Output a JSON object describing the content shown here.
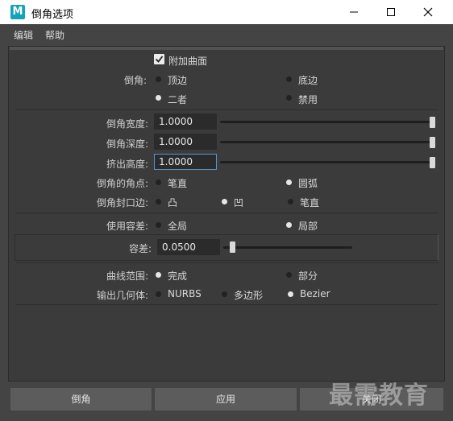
{
  "window": {
    "title": "倒角选项",
    "icon_letter": "M"
  },
  "menu": [
    "编辑",
    "帮助"
  ],
  "attach_surface": {
    "label": "附加曲面",
    "checked": true
  },
  "bevel": {
    "label": "倒角:",
    "options": [
      "顶边",
      "底边",
      "二者",
      "禁用"
    ],
    "selected": "二者"
  },
  "bevel_width": {
    "label": "倒角宽度:",
    "value": "1.0000"
  },
  "bevel_depth": {
    "label": "倒角深度:",
    "value": "1.0000"
  },
  "extrude_height": {
    "label": "挤出高度:",
    "value": "1.0000"
  },
  "bevel_corners": {
    "label": "倒角的角点:",
    "options": [
      "笔直",
      "圆弧"
    ],
    "selected": "圆弧"
  },
  "bevel_cap_edge": {
    "label": "倒角封口边:",
    "options": [
      "凸",
      "凹",
      "笔直"
    ],
    "selected": "凹"
  },
  "use_tolerance": {
    "label": "使用容差:",
    "options": [
      "全局",
      "局部"
    ],
    "selected": "局部"
  },
  "tolerance": {
    "label": "容差:",
    "value": "0.0500"
  },
  "curve_range": {
    "label": "曲线范围:",
    "options": [
      "完成",
      "部分"
    ],
    "selected": "完成"
  },
  "output_geometry": {
    "label": "输出几何体:",
    "options": [
      "NURBS",
      "多边形",
      "Bezier"
    ],
    "selected": "Bezier"
  },
  "buttons": {
    "bevel": "倒角",
    "apply": "应用",
    "close": "关闭"
  },
  "watermark": "最需教育"
}
